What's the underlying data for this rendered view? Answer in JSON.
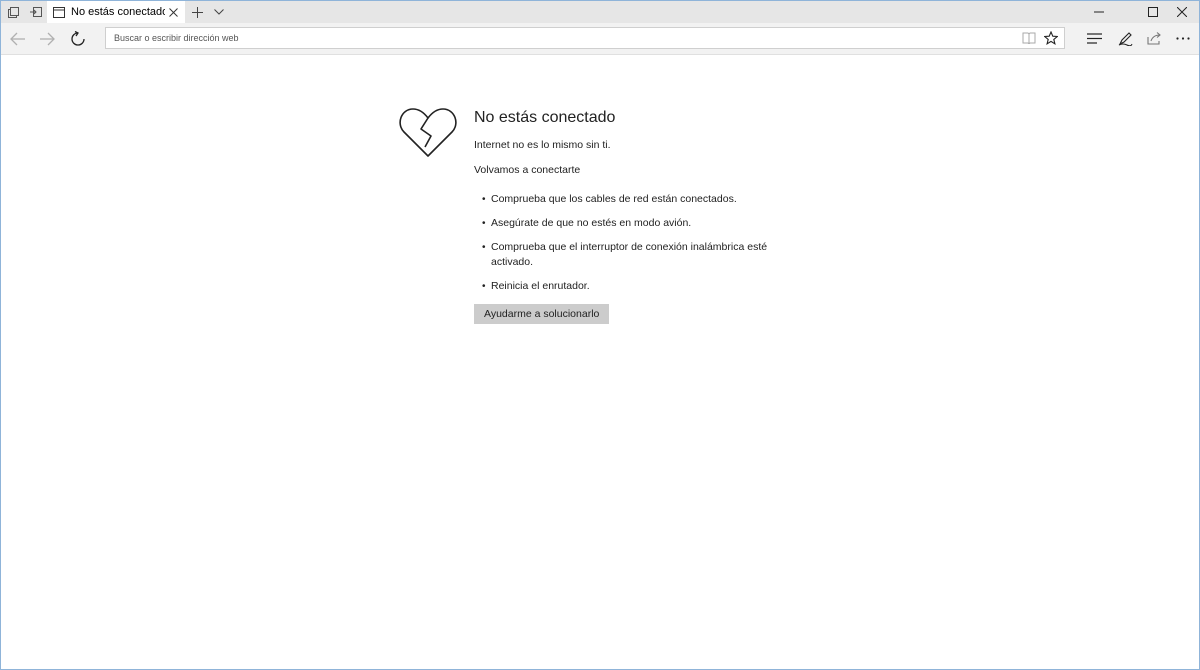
{
  "tab": {
    "title": "No estás conectado"
  },
  "address_bar": {
    "placeholder": "Buscar o escribir dirección web"
  },
  "page": {
    "title": "No estás conectado",
    "subtitle": "Internet no es lo mismo sin ti.",
    "reconnect_heading": "Volvamos a conectarte",
    "tips": [
      "Comprueba que los cables de red están conectados.",
      "Asegúrate de que no estés en modo avión.",
      "Comprueba que el interruptor de conexión inalámbrica esté activado.",
      "Reinicia el enrutador."
    ],
    "help_button": "Ayudarme a solucionarlo"
  },
  "icons": {
    "tab_preview": "tab-preview-icon",
    "set_aside": "set-aside-tabs-icon",
    "favicon": "page-icon",
    "close": "close-icon",
    "new_tab": "plus-icon",
    "tab_list": "chevron-down-icon",
    "minimize": "minimize-icon",
    "maximize": "maximize-icon",
    "window_close": "close-icon",
    "back": "back-arrow-icon",
    "forward": "forward-arrow-icon",
    "refresh": "refresh-icon",
    "reading_view": "book-icon",
    "favorite": "star-icon",
    "hub": "hub-icon",
    "web_note": "pen-icon",
    "share": "share-icon",
    "more": "more-icon",
    "broken_heart": "broken-heart-icon"
  },
  "colors": {
    "tabbar_bg": "#e6e6e6",
    "navbar_bg": "#f2f2f2",
    "button_bg": "#cccccc",
    "window_border": "#8fb4d9"
  }
}
